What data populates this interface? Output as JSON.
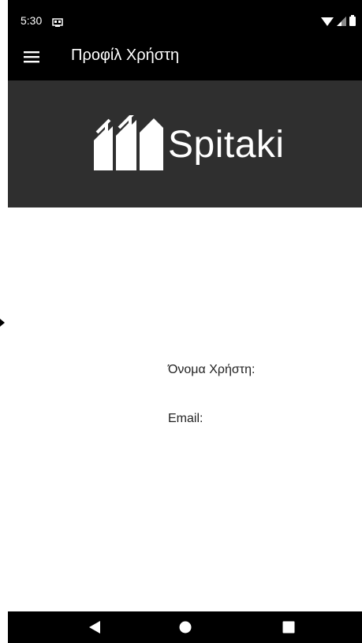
{
  "status_bar": {
    "time": "5:30",
    "notification_icon": "cast-icon",
    "wifi_icon": "wifi-icon",
    "signal_icon": "signal-icon",
    "battery_icon": "battery-icon"
  },
  "app_bar": {
    "title": "Προφίλ Χρήστη",
    "menu_icon": "hamburger-menu-icon"
  },
  "banner": {
    "logo_text": "Spitaki",
    "logo_icon": "houses-logo-icon"
  },
  "profile": {
    "username_label": "Όνομα Χρήστη:",
    "email_label": "Email:"
  },
  "nav_bar": {
    "back_icon": "back-triangle-icon",
    "home_icon": "home-circle-icon",
    "recents_icon": "recents-square-icon"
  },
  "colors": {
    "bar_background": "#000000",
    "banner_background": "#2f2f2f",
    "page_background": "#ffffff"
  }
}
